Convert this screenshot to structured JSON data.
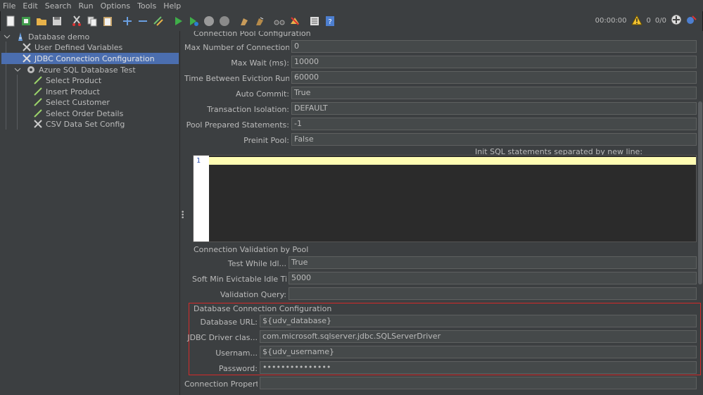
{
  "menu": [
    "File",
    "Edit",
    "Search",
    "Run",
    "Options",
    "Tools",
    "Help"
  ],
  "toolbar": {
    "timer": "00:00:00",
    "warnings": "0",
    "threads": "0/0"
  },
  "tree": {
    "root": "Database demo",
    "items": [
      {
        "label": "User Defined Variables"
      },
      {
        "label": "JDBC Connection Configuration",
        "selected": true
      },
      {
        "label": "Azure SQL Database Test"
      },
      {
        "label": "Select Product"
      },
      {
        "label": "Insert Product"
      },
      {
        "label": "Select Customer"
      },
      {
        "label": "Select Order Details"
      },
      {
        "label": "CSV Data Set Config"
      }
    ]
  },
  "pool": {
    "title": "Connection Pool Configuration",
    "rows": [
      {
        "label": "Max Number of Connections:",
        "value": "0"
      },
      {
        "label": "Max Wait (ms):",
        "value": "10000"
      },
      {
        "label": "Time Between Eviction Runs (ms):",
        "value": "60000"
      },
      {
        "label": "Auto Commit:",
        "value": "True"
      },
      {
        "label": "Transaction Isolation:",
        "value": "DEFAULT"
      },
      {
        "label": "Pool Prepared Statements:",
        "value": "-1"
      },
      {
        "label": "Preinit Pool:",
        "value": "False"
      }
    ],
    "init_sql_label": "Init SQL statements separated by new line:",
    "line_number": "1"
  },
  "validation": {
    "title": "Connection Validation by Pool",
    "rows": [
      {
        "label": "Test While Idl...",
        "value": "True"
      },
      {
        "label": "Soft Min Evictable Idle Time(m...",
        "value": "5000"
      },
      {
        "label": "Validation Query:",
        "value": ""
      }
    ]
  },
  "database": {
    "title": "Database Connection Configuration",
    "rows": [
      {
        "label": "Database URL:",
        "value": "${udv_database}"
      },
      {
        "label": "JDBC Driver clas...",
        "value": "com.microsoft.sqlserver.jdbc.SQLServerDriver"
      },
      {
        "label": "Usernam...",
        "value": "${udv_username}"
      },
      {
        "label": "Password:",
        "value": "•••••••••••••••"
      }
    ],
    "extra_label": "Connection Properti...",
    "highlight_color": "#d42a2a"
  },
  "colors": {
    "selection": "#4b6eaf",
    "background": "#3c3f41"
  }
}
